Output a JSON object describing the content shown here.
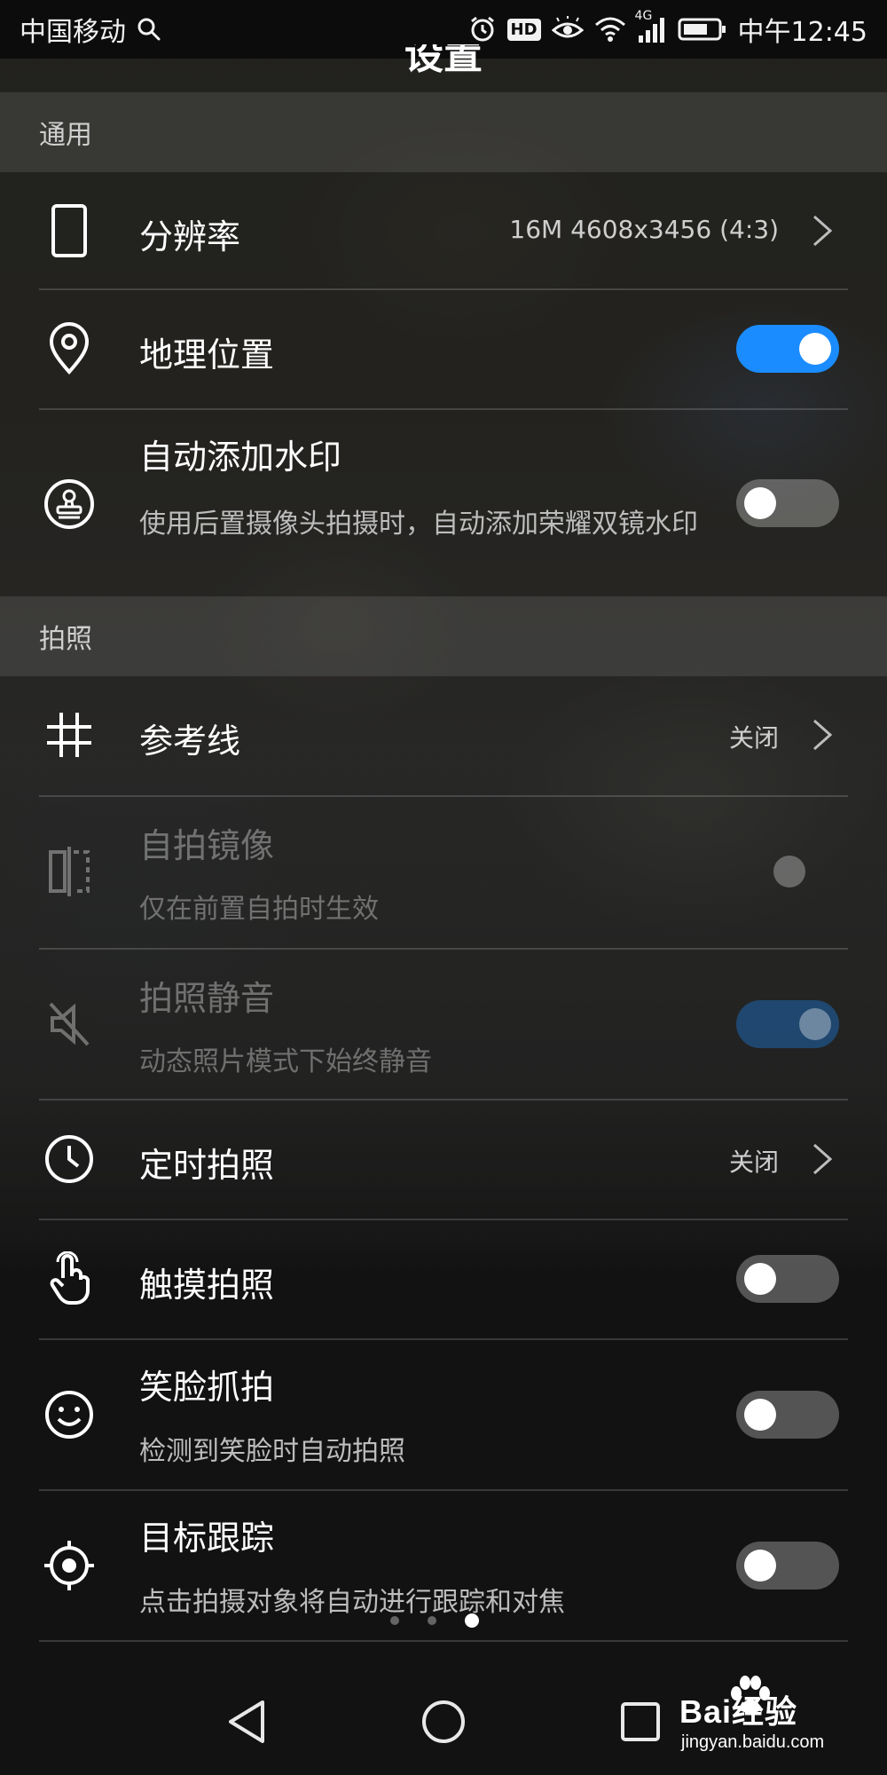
{
  "status_bar": {
    "carrier": "中国移动",
    "hd_badge": "HD",
    "network": "4G",
    "time": "中午12:45"
  },
  "page": {
    "title": "设置"
  },
  "sections": {
    "general": "通用",
    "photo": "拍照"
  },
  "settings": {
    "resolution": {
      "label": "分辨率",
      "value": "16M 4608x3456 (4:3)",
      "icon": "phone-icon"
    },
    "location": {
      "label": "地理位置",
      "enabled": true,
      "icon": "location-pin-icon"
    },
    "watermark": {
      "label": "自动添加水印",
      "sub": "使用后置摄像头拍摄时，自动添加荣耀双镜水印",
      "enabled": false,
      "icon": "stamp-icon"
    },
    "grid": {
      "label": "参考线",
      "value": "关闭",
      "icon": "grid-icon"
    },
    "mirror": {
      "label": "自拍镜像",
      "sub": "仅在前置自拍时生效",
      "enabled": false,
      "disabled": true,
      "icon": "mirror-icon"
    },
    "mute": {
      "label": "拍照静音",
      "sub": "动态照片模式下始终静音",
      "enabled": true,
      "disabled": true,
      "icon": "mute-icon"
    },
    "timer": {
      "label": "定时拍照",
      "value": "关闭",
      "icon": "clock-icon"
    },
    "touch": {
      "label": "触摸拍照",
      "enabled": false,
      "icon": "touch-icon"
    },
    "smile": {
      "label": "笑脸抓拍",
      "sub": "检测到笑脸时自动拍照",
      "enabled": false,
      "icon": "smile-icon"
    },
    "tracking": {
      "label": "目标跟踪",
      "sub": "点击拍摄对象将自动进行跟踪和对焦",
      "enabled": false,
      "icon": "target-icon"
    }
  },
  "page_indicator": {
    "count": 3,
    "active": 3
  },
  "watermark": {
    "brand": "Bai经验",
    "url": "jingyan.baidu.com"
  },
  "colors": {
    "toggle_on": "#1a8cff",
    "background": "#121212"
  }
}
